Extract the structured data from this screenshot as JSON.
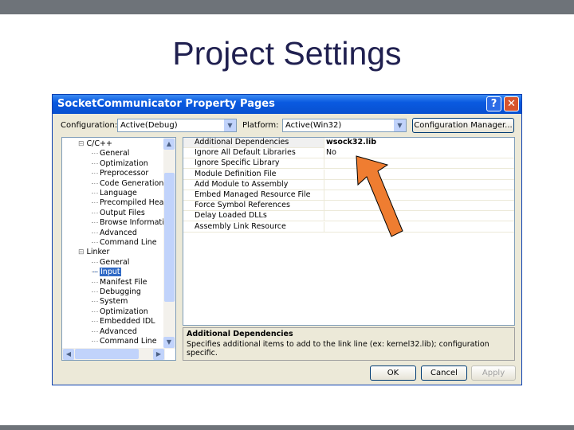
{
  "slide": {
    "title": "Project Settings"
  },
  "dialog": {
    "title": "SocketCommunicator Property Pages",
    "help_label": "?",
    "close_label": "✕",
    "configuration_label": "Configuration:",
    "configuration_value": "Active(Debug)",
    "platform_label": "Platform:",
    "platform_value": "Active(Win32)",
    "config_manager_label": "Configuration Manager...",
    "tree": [
      {
        "label": "C/C++",
        "level": 0,
        "expander": "⊟"
      },
      {
        "label": "General",
        "level": 1
      },
      {
        "label": "Optimization",
        "level": 1
      },
      {
        "label": "Preprocessor",
        "level": 1
      },
      {
        "label": "Code Generation",
        "level": 1
      },
      {
        "label": "Language",
        "level": 1
      },
      {
        "label": "Precompiled Heac",
        "level": 1
      },
      {
        "label": "Output Files",
        "level": 1
      },
      {
        "label": "Browse Informatic",
        "level": 1
      },
      {
        "label": "Advanced",
        "level": 1
      },
      {
        "label": "Command Line",
        "level": 1
      },
      {
        "label": "Linker",
        "level": 0,
        "expander": "⊟"
      },
      {
        "label": "General",
        "level": 1
      },
      {
        "label": "Input",
        "level": 1,
        "selected": true
      },
      {
        "label": "Manifest File",
        "level": 1
      },
      {
        "label": "Debugging",
        "level": 1
      },
      {
        "label": "System",
        "level": 1
      },
      {
        "label": "Optimization",
        "level": 1
      },
      {
        "label": "Embedded IDL",
        "level": 1
      },
      {
        "label": "Advanced",
        "level": 1
      },
      {
        "label": "Command Line",
        "level": 1
      }
    ],
    "properties": [
      {
        "name": "Additional Dependencies",
        "value": "wsock32.lib",
        "bold": true
      },
      {
        "name": "Ignore All Default Libraries",
        "value": "No"
      },
      {
        "name": "Ignore Specific Library",
        "value": ""
      },
      {
        "name": "Module Definition File",
        "value": ""
      },
      {
        "name": "Add Module to Assembly",
        "value": ""
      },
      {
        "name": "Embed Managed Resource File",
        "value": ""
      },
      {
        "name": "Force Symbol References",
        "value": ""
      },
      {
        "name": "Delay Loaded DLLs",
        "value": ""
      },
      {
        "name": "Assembly Link Resource",
        "value": ""
      }
    ],
    "description_title": "Additional Dependencies",
    "description_text": "Specifies additional items to add to the link line (ex: kernel32.lib); configuration specific.",
    "ok_label": "OK",
    "cancel_label": "Cancel",
    "apply_label": "Apply"
  },
  "colors": {
    "arrow": "#ef7d31",
    "titlebar": "#0a5ae0",
    "selection": "#316ac5"
  }
}
